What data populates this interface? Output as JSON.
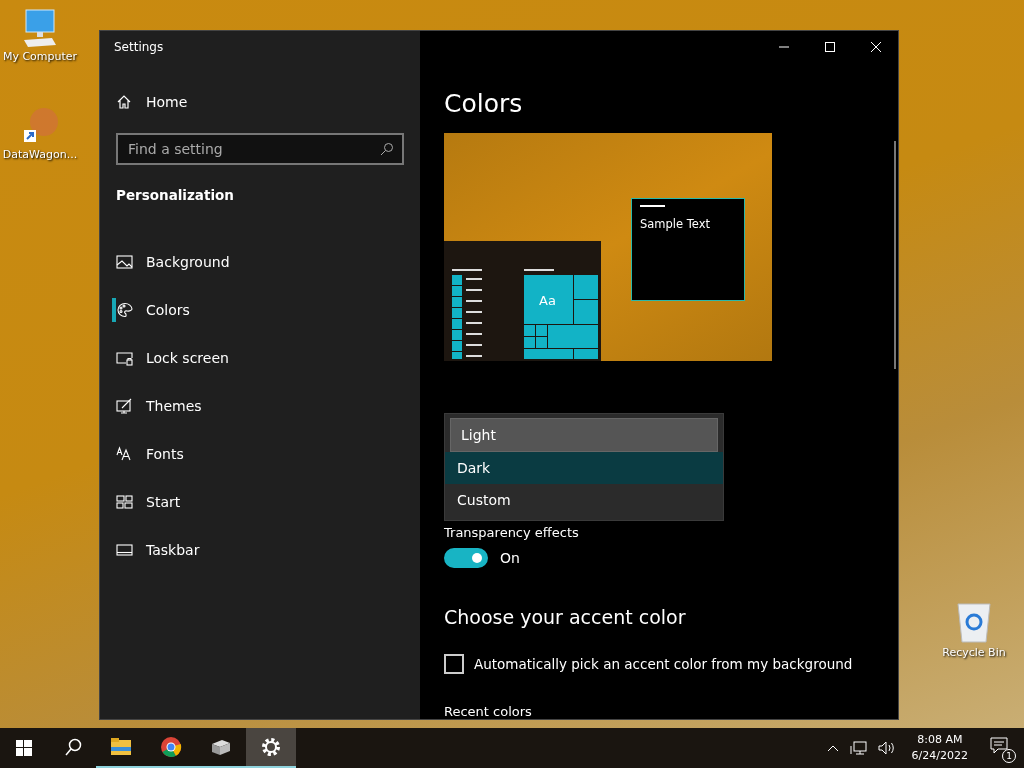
{
  "desktop_icons": [
    {
      "kind": "computer",
      "label": "My Computer"
    },
    {
      "kind": "shortcut",
      "label": "DataWagon..."
    },
    {
      "kind": "recycle",
      "label": "Recycle Bin"
    }
  ],
  "window": {
    "title": "Settings"
  },
  "sidebar": {
    "home": "Home",
    "search": {
      "placeholder": "Find a setting"
    },
    "section": "Personalization",
    "items": [
      {
        "kind": "picture",
        "label": "Background",
        "selected": false
      },
      {
        "kind": "palette",
        "label": "Colors",
        "selected": true
      },
      {
        "kind": "lock",
        "label": "Lock screen",
        "selected": false
      },
      {
        "kind": "themes",
        "label": "Themes",
        "selected": false
      },
      {
        "kind": "fonts",
        "label": "Fonts",
        "selected": false
      },
      {
        "kind": "start",
        "label": "Start",
        "selected": false
      },
      {
        "kind": "taskbar",
        "label": "Taskbar",
        "selected": false
      }
    ]
  },
  "content": {
    "title": "Colors",
    "preview": {
      "sample_text": "Sample Text",
      "tile_text": "Aa"
    },
    "mode_dropdown": {
      "options": [
        {
          "label": "Light",
          "selected": false,
          "highlighted": true
        },
        {
          "label": "Dark",
          "selected": true,
          "highlighted": false
        },
        {
          "label": "Custom",
          "selected": false,
          "highlighted": false
        }
      ]
    },
    "transparency": {
      "label": "Transparency effects",
      "on": true,
      "state_text": "On"
    },
    "accent_heading": "Choose your accent color",
    "auto_pick": {
      "label": "Automatically pick an accent color from my background",
      "checked": false
    },
    "recent_colors_label": "Recent colors"
  },
  "taskbar": {
    "apps": [
      {
        "kind": "explorer",
        "active": false
      },
      {
        "kind": "browser",
        "active": false
      },
      {
        "kind": "package",
        "active": false
      },
      {
        "kind": "settings",
        "active": true
      }
    ],
    "time": "8:08 AM",
    "date": "6/24/2022",
    "notification_count": "1"
  }
}
